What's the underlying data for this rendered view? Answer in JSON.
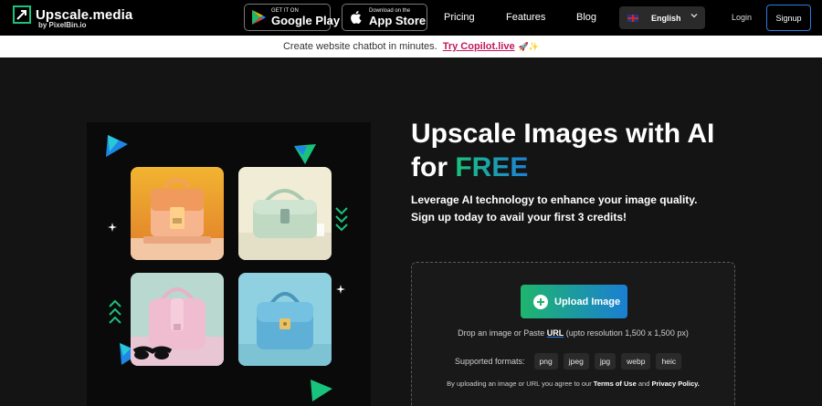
{
  "header": {
    "logo_title": "Upscale.media",
    "logo_subtitle": "by PixelBin.io",
    "google_play": {
      "small": "GET IT ON",
      "big": "Google Play"
    },
    "app_store": {
      "small": "Download on the",
      "big": "App Store"
    },
    "nav": {
      "pricing": "Pricing",
      "features": "Features",
      "blog": "Blog"
    },
    "language": "English",
    "login": "Login",
    "signup": "Signup"
  },
  "banner": {
    "text": "Create website chatbot in minutes.",
    "link": "Try Copilot.live",
    "emoji": "🚀✨"
  },
  "hero": {
    "title_line1": "Upscale Images with AI",
    "title_for": "for ",
    "title_free": "FREE",
    "subtitle": "Leverage AI technology to enhance your image quality. Sign up today to avail your first 3 credits!"
  },
  "upload": {
    "button": "Upload Image",
    "drop_prefix": "Drop an image or Paste ",
    "drop_url": "URL",
    "drop_suffix": " (upto resolution 1,500 x 1,500 px)",
    "formats_label": "Supported formats:",
    "formats": [
      "png",
      "jpeg",
      "jpg",
      "webp",
      "heic"
    ],
    "terms_prefix": "By uploading an image or URL you agree to our ",
    "terms_link": "Terms of Use",
    "terms_and": " and ",
    "privacy_link": "Privacy Policy."
  },
  "colors": {
    "accent_green": "#1fb56d",
    "accent_blue": "#1a7fd3",
    "banner_link": "#c2185b",
    "signup_border": "#2a7be0"
  },
  "icons": [
    "upscale-logo-icon",
    "google-play-icon",
    "apple-icon",
    "uk-flag-icon",
    "chevron-down-icon",
    "plus-circle-icon"
  ]
}
